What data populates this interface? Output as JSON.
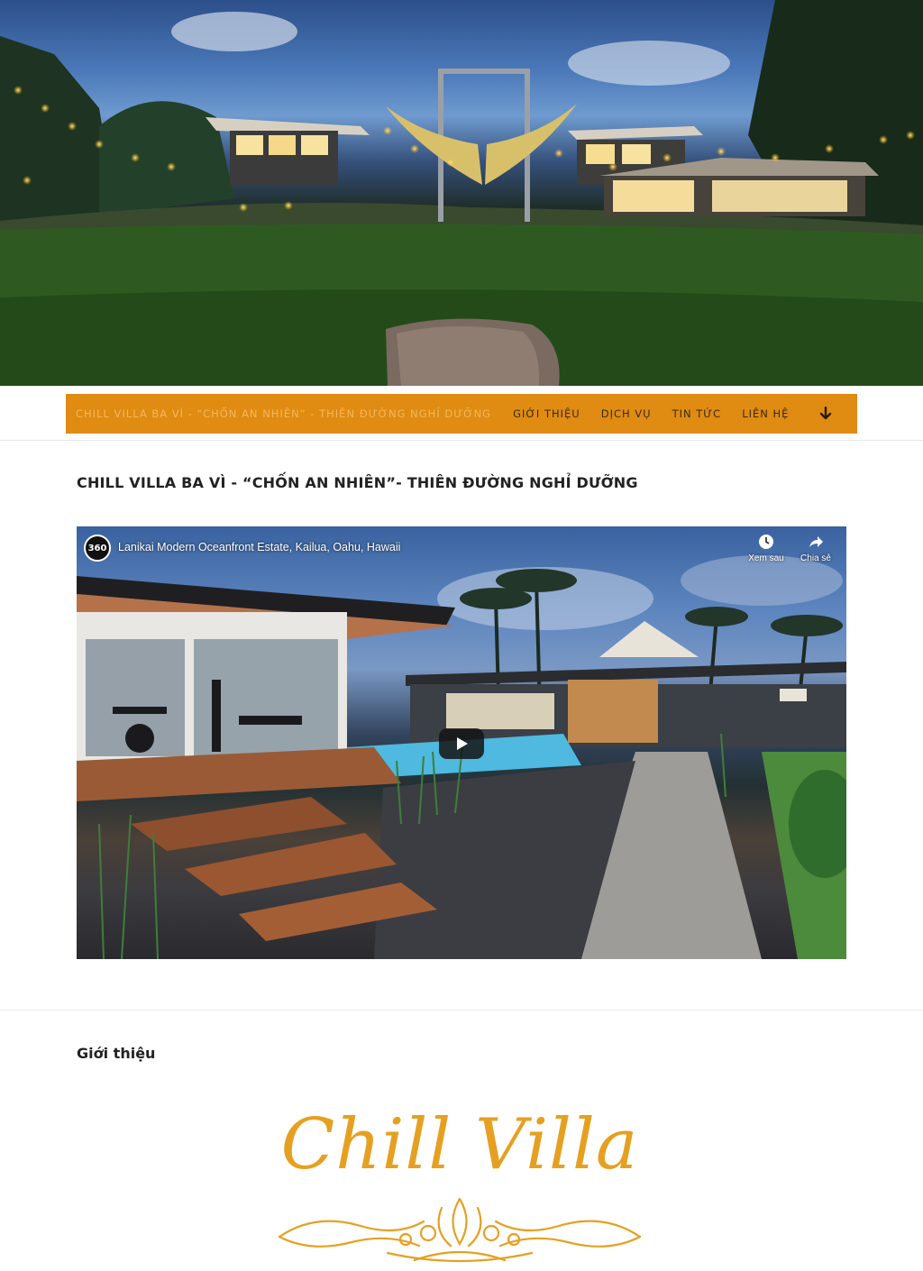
{
  "nav": {
    "brand": "CHILL VILLA BA VÌ - “CHỐN AN NHIÊN” - THIÊN ĐƯỜNG NGHỈ DƯỠNG",
    "items": [
      "GIỚI THIỆU",
      "DỊCH VỤ",
      "TIN TỨC",
      "LIÊN HỆ"
    ],
    "more_icon": "arrow-down-icon",
    "background": "#e08b12"
  },
  "page": {
    "title": "CHILL VILLA BA VÌ - “CHỐN AN NHIÊN”- THIÊN ĐƯỜNG NGHỈ DƯỠNG"
  },
  "video": {
    "badge": "360",
    "title": "Lanikai Modern Oceanfront Estate, Kailua, Oahu, Hawaii",
    "watch_later": "Xem sau",
    "share": "Chia sẻ"
  },
  "section": {
    "title": "Giới thiệu"
  },
  "logo": {
    "text": "Chill Villa",
    "color": "#e6a021"
  }
}
